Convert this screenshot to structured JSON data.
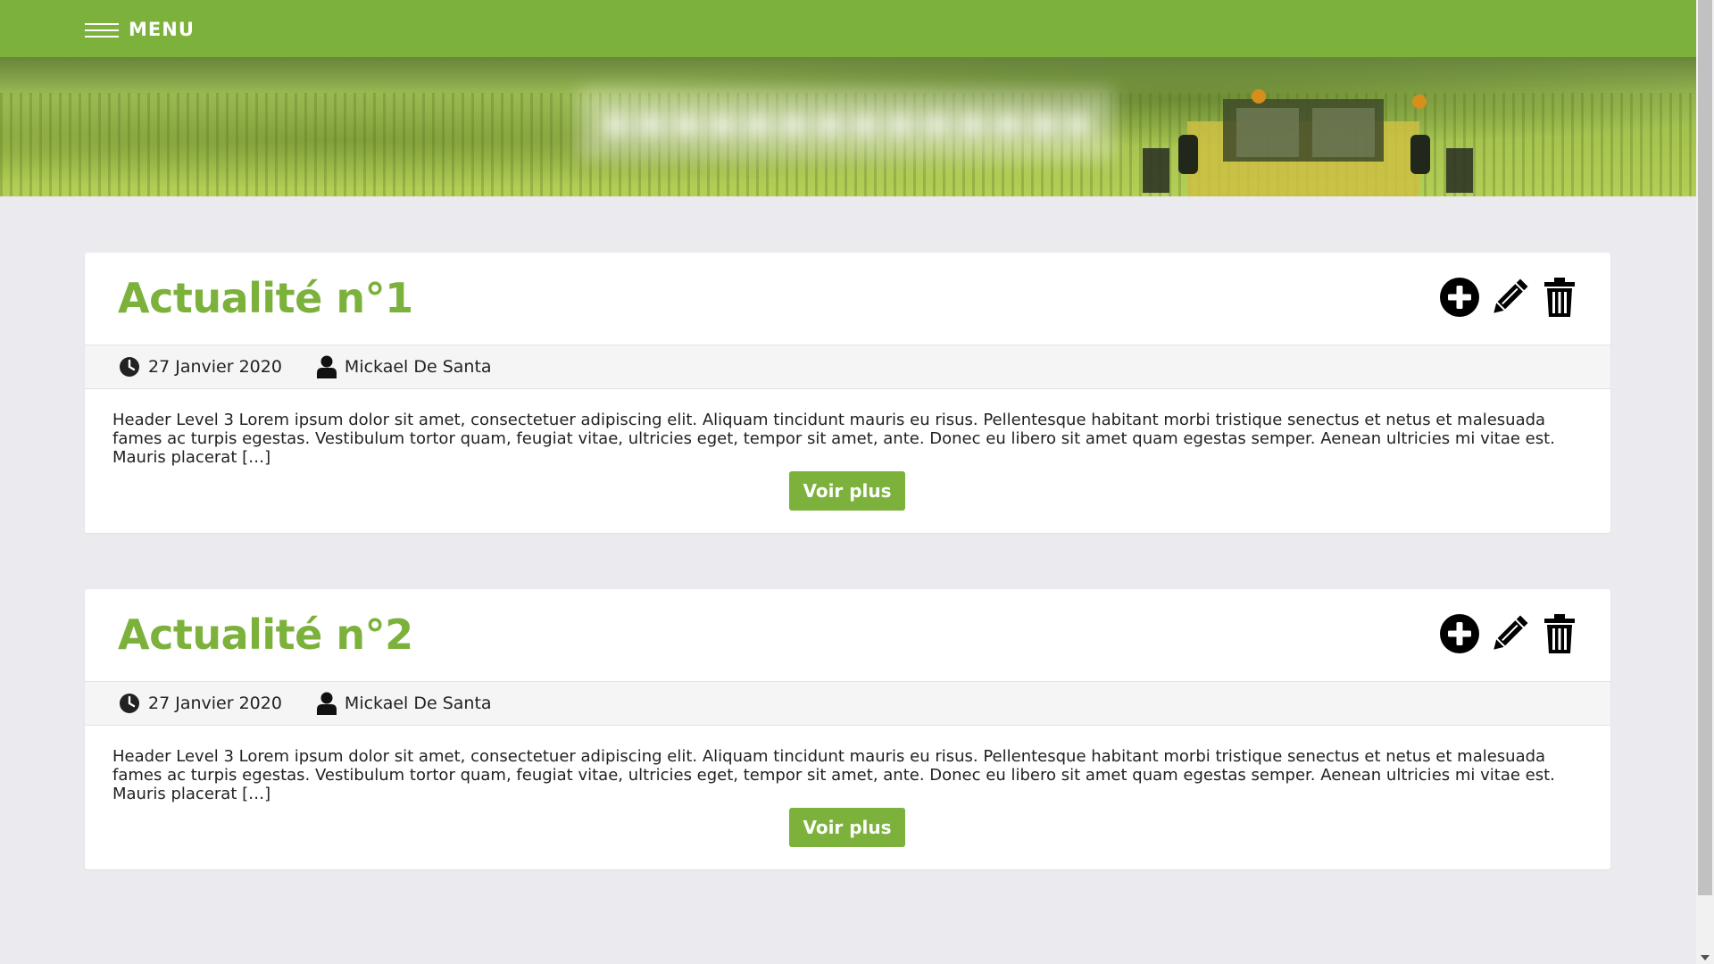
{
  "header": {
    "menu_label": "MENU"
  },
  "articles": [
    {
      "title": "Actualité n°1",
      "date": "27 Janvier 2020",
      "author": "Mickael De Santa",
      "excerpt": "Header Level 3 Lorem ipsum dolor sit amet, consectetuer adipiscing elit. Aliquam tincidunt mauris eu risus. Pellentesque habitant morbi tristique senectus et netus et malesuada fames ac turpis egestas. Vestibulum tortor quam, feugiat vitae, ultricies eget, tempor sit amet, ante. Donec eu libero sit amet quam egestas semper. Aenean ultricies mi vitae est. Mauris placerat […]",
      "button_label": "Voir plus"
    },
    {
      "title": "Actualité n°2",
      "date": "27 Janvier 2020",
      "author": "Mickael De Santa",
      "excerpt": "Header Level 3 Lorem ipsum dolor sit amet, consectetuer adipiscing elit. Aliquam tincidunt mauris eu risus. Pellentesque habitant morbi tristique senectus et netus et malesuada fames ac turpis egestas. Vestibulum tortor quam, feugiat vitae, ultricies eget, tempor sit amet, ante. Donec eu libero sit amet quam egestas semper. Aenean ultricies mi vitae est. Mauris placerat […]",
      "button_label": "Voir plus"
    }
  ],
  "icons": {
    "menu": "hamburger-icon",
    "add": "plus-circle-icon",
    "edit": "pencil-icon",
    "delete": "trash-icon",
    "date": "clock-icon",
    "author": "user-icon"
  },
  "colors": {
    "accent": "#7cb13b",
    "background": "#ebebef",
    "card": "#ffffff",
    "meta_bar": "#f5f5f5",
    "text": "#222222"
  }
}
